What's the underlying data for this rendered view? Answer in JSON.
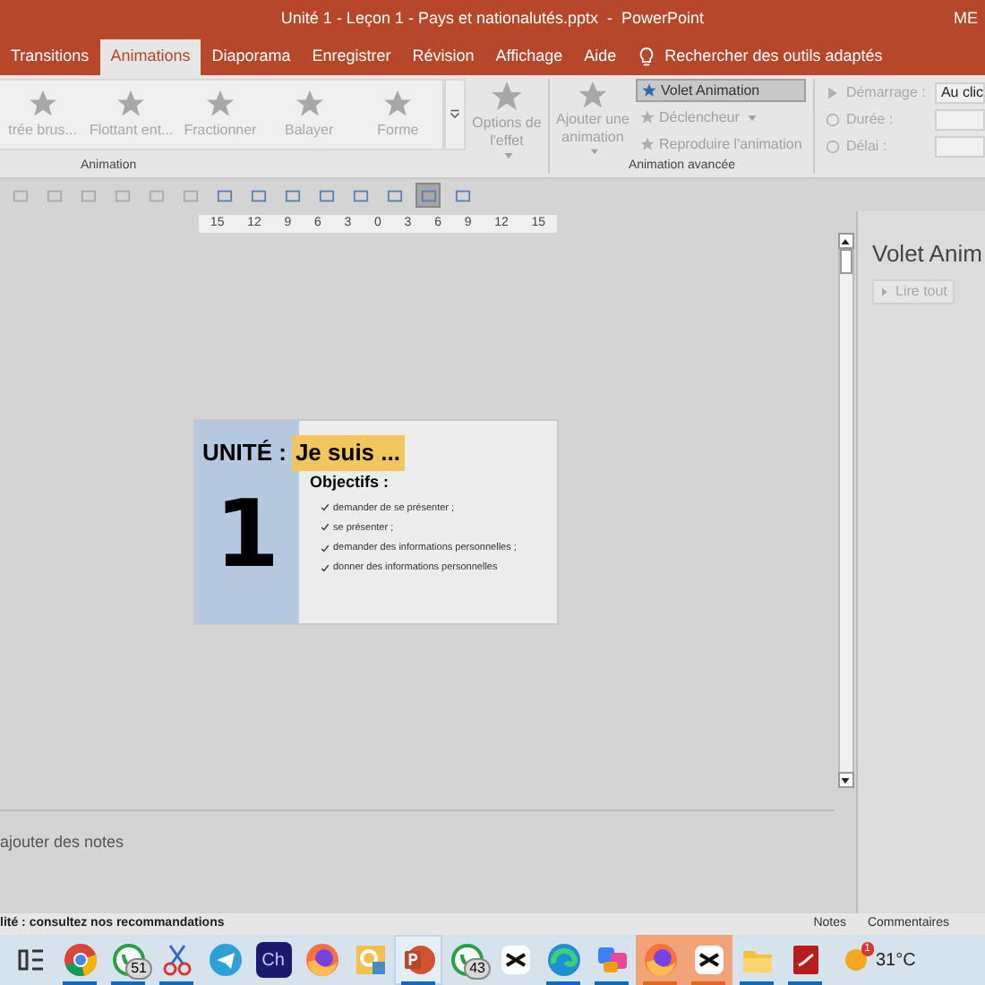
{
  "window": {
    "title": "Unité 1 - Leçon 1 - Pays et nationalutés.pptx  -  PowerPoint",
    "user": "ME"
  },
  "tabs": [
    {
      "label": "Transitions",
      "selected": false
    },
    {
      "label": "Animations",
      "selected": true
    },
    {
      "label": "Diaporama",
      "selected": false
    },
    {
      "label": "Enregistrer",
      "selected": false
    },
    {
      "label": "Révision",
      "selected": false
    },
    {
      "label": "Affichage",
      "selected": false
    },
    {
      "label": "Aide",
      "selected": false
    }
  ],
  "search": {
    "placeholder": "Rechercher des outils adaptés"
  },
  "ribbon": {
    "effects": [
      {
        "label": "trée brus..."
      },
      {
        "label": "Flottant ent..."
      },
      {
        "label": "Fractionner"
      },
      {
        "label": "Balayer"
      },
      {
        "label": "Forme"
      }
    ],
    "effect_options": {
      "label": "Options de l'effet",
      "disabled": true
    },
    "group_animation": "Animation",
    "add_animation": {
      "label": "Ajouter une animation",
      "disabled": true
    },
    "advanced": [
      {
        "label": "Volet Animation",
        "selected": true,
        "disabled": false
      },
      {
        "label": "Déclencheur",
        "selected": false,
        "disabled": true
      },
      {
        "label": "Reproduire l'animation",
        "selected": false,
        "disabled": true
      }
    ],
    "group_advanced": "Animation avancée",
    "timing": [
      {
        "label": "Démarrage :",
        "value": "Au clic"
      },
      {
        "label": "Durée :"
      },
      {
        "label": "Délai :"
      }
    ]
  },
  "toolbar": [
    {
      "selected": false
    },
    {
      "selected": false
    },
    {
      "selected": false
    },
    {
      "selected": false
    },
    {
      "selected": false
    },
    {
      "selected": false
    },
    {
      "selected": false
    },
    {
      "selected": false
    },
    {
      "selected": false
    },
    {
      "selected": false
    },
    {
      "selected": false
    },
    {
      "selected": false
    },
    {
      "selected": true
    },
    {
      "selected": false
    }
  ],
  "ruler": [
    "15",
    "12",
    "9",
    "6",
    "3",
    "0",
    "3",
    "6",
    "9",
    "12",
    "15"
  ],
  "slide": {
    "unit": "UNITÉ :",
    "title": "Je suis ...",
    "number": "1",
    "objectives_title": "Objectifs :",
    "objectives": [
      "demander de se présenter ;",
      "se présenter ;",
      "demander des informations personnelles ;",
      "donner des informations personnelles"
    ]
  },
  "notes": {
    "placeholder": "ajouter des notes"
  },
  "pane": {
    "title": "Volet Anim",
    "play": "Lire tout"
  },
  "status_bar": {
    "message": "lité : consultez nos recommandations",
    "notes": "Notes",
    "comments": "Commentaires"
  },
  "taskbar": {
    "apps": [
      {
        "kind": "taskview",
        "open": false,
        "attention": false,
        "selected": false
      },
      {
        "kind": "chrome",
        "open": true,
        "attention": false,
        "selected": false
      },
      {
        "kind": "whatsapp",
        "open": true,
        "attention": false,
        "selected": false,
        "badge": "51"
      },
      {
        "kind": "snip",
        "open": true,
        "attention": false,
        "selected": false
      },
      {
        "kind": "telegram",
        "open": false,
        "attention": false,
        "selected": false
      },
      {
        "kind": "ch",
        "open": false,
        "attention": false,
        "selected": false,
        "label": "Ch"
      },
      {
        "kind": "firefox",
        "open": false,
        "attention": false,
        "selected": false
      },
      {
        "kind": "paint",
        "open": false,
        "attention": false,
        "selected": false
      },
      {
        "kind": "powerpoint",
        "open": true,
        "attention": false,
        "selected": true
      },
      {
        "kind": "whatsapp",
        "open": false,
        "attention": false,
        "selected": false,
        "badge": "43"
      },
      {
        "kind": "capcut",
        "open": false,
        "attention": false,
        "selected": false
      },
      {
        "kind": "edge",
        "open": true,
        "attention": false,
        "selected": false
      },
      {
        "kind": "copilot",
        "open": true,
        "attention": false,
        "selected": false
      },
      {
        "kind": "firefox",
        "open": true,
        "attention": true,
        "selected": false
      },
      {
        "kind": "capcut",
        "open": true,
        "attention": true,
        "selected": false
      },
      {
        "kind": "folder",
        "open": true,
        "attention": false,
        "selected": false
      },
      {
        "kind": "pdf",
        "open": true,
        "attention": false,
        "selected": false
      }
    ],
    "weather": {
      "badge": "1",
      "temperature": "31°C"
    }
  }
}
